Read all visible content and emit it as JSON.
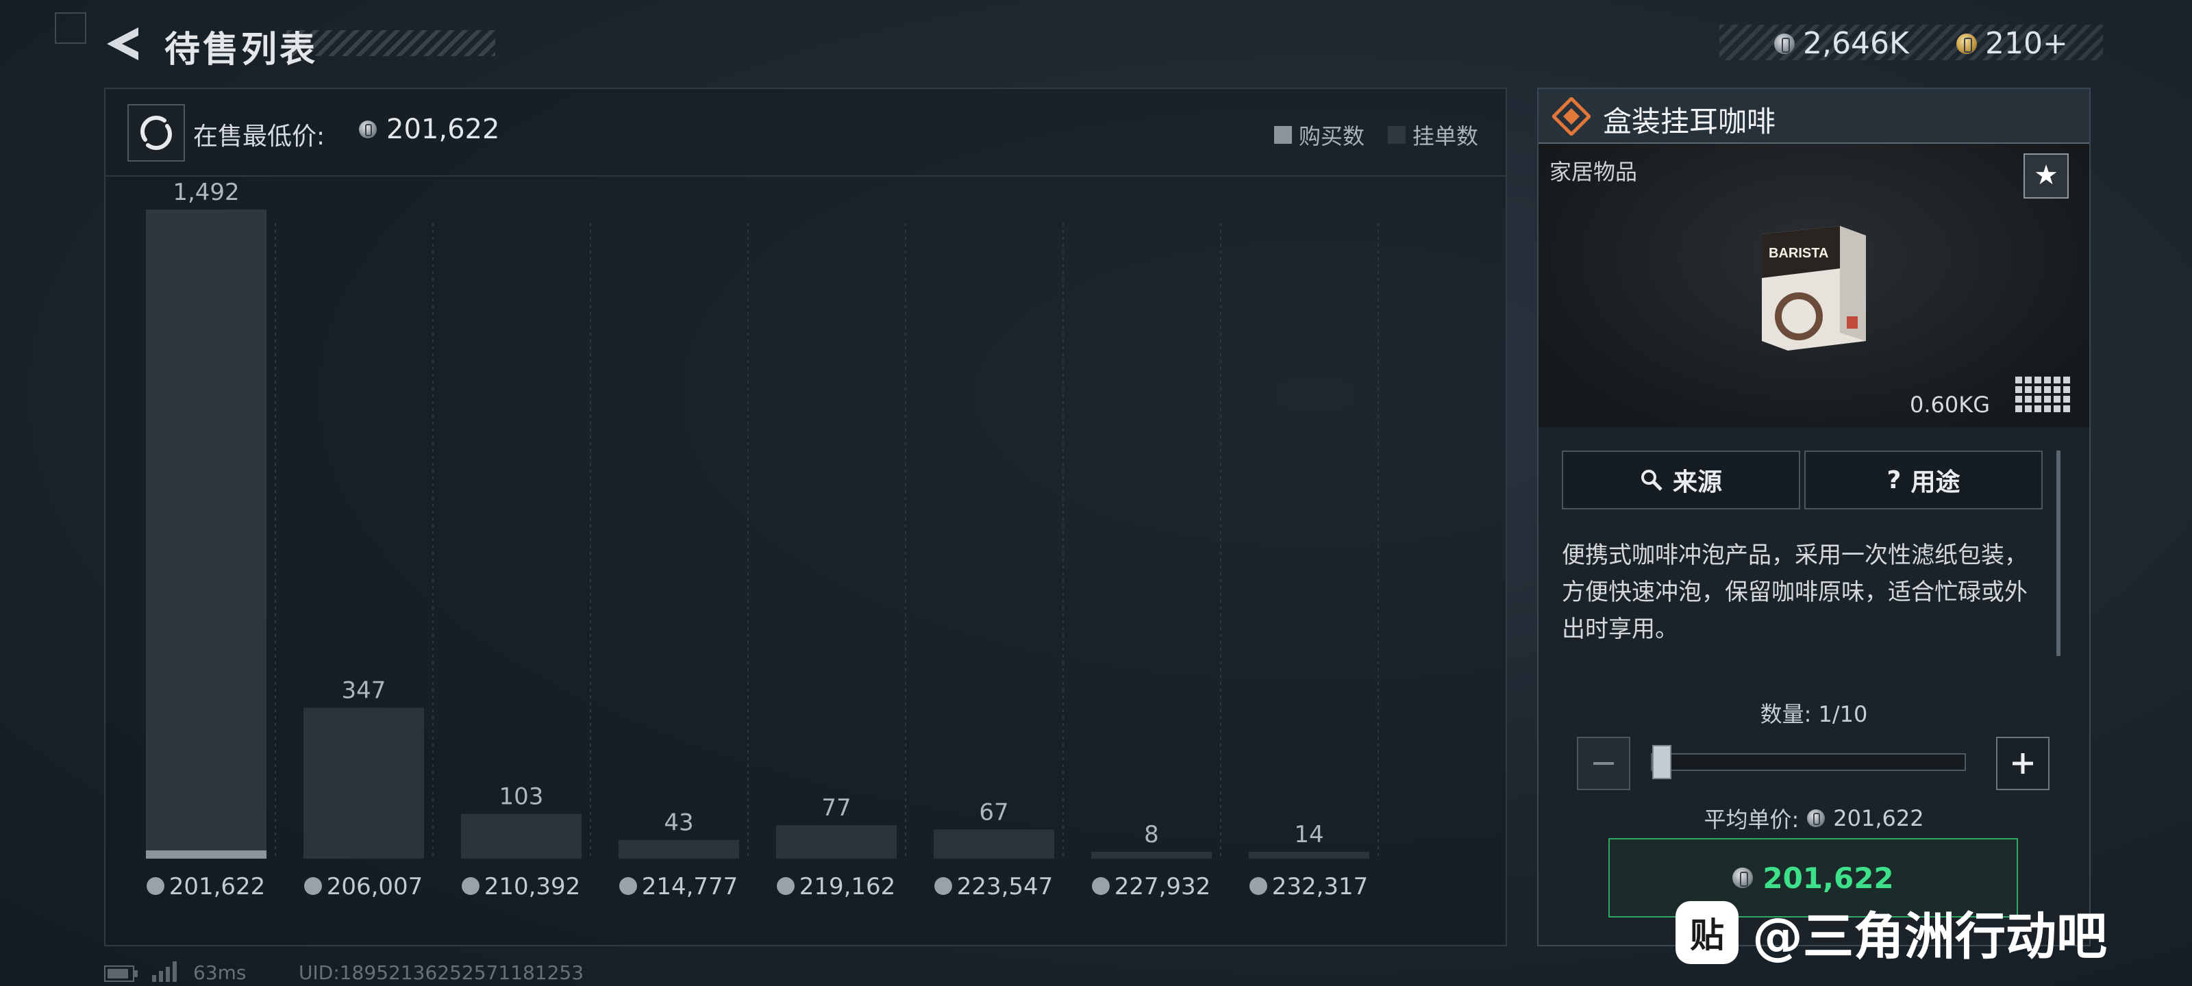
{
  "header": {
    "title": "待售列表",
    "currency": [
      {
        "icon": "silver-coin-icon",
        "value": "2,646K"
      },
      {
        "icon": "gold-coin-icon",
        "value": "210+"
      }
    ]
  },
  "chart_panel": {
    "min_price_label": "在售最低价:",
    "min_price_value": "201,622",
    "legend": [
      {
        "label": "购买数",
        "color": "#8d959b"
      },
      {
        "label": "挂单数",
        "color": "#2f383f"
      }
    ]
  },
  "chart_data": {
    "type": "bar",
    "categories": [
      "201,622",
      "206,007",
      "210,392",
      "214,777",
      "219,162",
      "223,547",
      "227,932",
      "232,317"
    ],
    "series": [
      {
        "name": "挂单数",
        "values": [
          1492,
          347,
          103,
          43,
          77,
          67,
          8,
          14
        ]
      },
      {
        "name": "购买数",
        "values": [
          25,
          0,
          0,
          0,
          0,
          0,
          0,
          0
        ]
      }
    ],
    "value_labels": [
      "1,492",
      "347",
      "103",
      "43",
      "77",
      "67",
      "8",
      "14"
    ],
    "ylim": [
      0,
      1492
    ],
    "grid": true
  },
  "item": {
    "name": "盒装挂耳咖啡",
    "category": "家居物品",
    "weight": "0.60KG",
    "buttons": {
      "source": "来源",
      "usage": "用途"
    },
    "description": "便携式咖啡冲泡产品，采用一次性滤纸包装，方便快速冲泡，保留咖啡原味，适合忙碌或外出时享用。",
    "quantity_label": "数量: 1/10",
    "quantity_fraction": 0.1,
    "avg_price_label": "平均单价:",
    "avg_price_value": "201,622",
    "buy_price": "201,622",
    "package_text": "BARISTA"
  },
  "footer": {
    "latency": "63ms",
    "uid": "UID:18952136252571181253"
  },
  "watermark": {
    "logo_text": "贴",
    "text": "@三角洲行动吧"
  }
}
